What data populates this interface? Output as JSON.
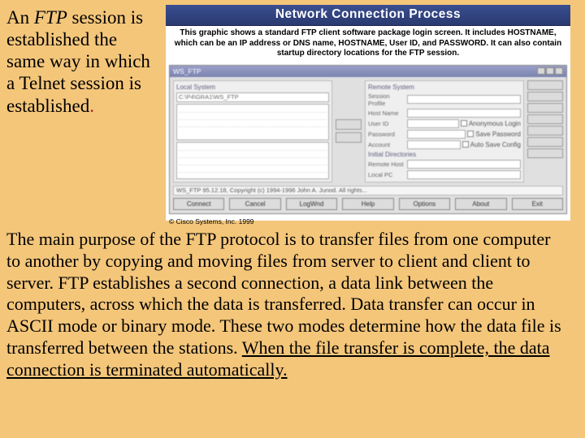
{
  "intro": {
    "line1_pre": "An ",
    "line1_ftp": "FTP",
    "line1_post": " session",
    "rest": "is established the same way in which a Telnet session is established",
    "dot": "."
  },
  "figure": {
    "banner": "Network Connection Process",
    "caption": "This graphic shows a standard FTP client software package login screen. It includes HOSTNAME, which can be an IP address or DNS name, HOSTNAME, User ID, and PASSWORD. It can also contain startup directory locations for the FTP session.",
    "app": {
      "title": "WS_FTP",
      "local_label": "Local System",
      "remote_label": "Remote System",
      "local_path": "C:\\P4\\GRA1\\WS_FTP",
      "fields": {
        "profile": "Session Profile",
        "host": "Host Name",
        "user": "User ID",
        "pass": "Password",
        "acct": "Account",
        "initdir": "Initial Directories",
        "remote_dir": "Remote Host",
        "local_dir": "Local PC",
        "anon": "Anonymous Login",
        "savepw": "Save Password",
        "autosave": "Auto Save Config"
      },
      "status": "WS_FTP 95.12.18, Copyright (c) 1994-1996 John A. Junod. All rights...",
      "buttons": {
        "connect": "Connect",
        "cancel": "Cancel",
        "logwnd": "LogWnd",
        "help": "Help",
        "options": "Options",
        "about": "About",
        "exit": "Exit"
      }
    },
    "copyright": "© Cisco Systems, Inc. 1999"
  },
  "main": {
    "p1": "The main purpose of the FTP protocol is to transfer files from one computer to another by copying and moving files from server to client and client to server.  FTP establishes a second connection, a data link between the computers, across which the data is transferred. Data transfer can occur in ASCII mode or binary mode. These two modes determine how the data file is transferred between the stations. ",
    "p1_u": "When the file transfer is complete, the data connection is terminated automatically."
  }
}
